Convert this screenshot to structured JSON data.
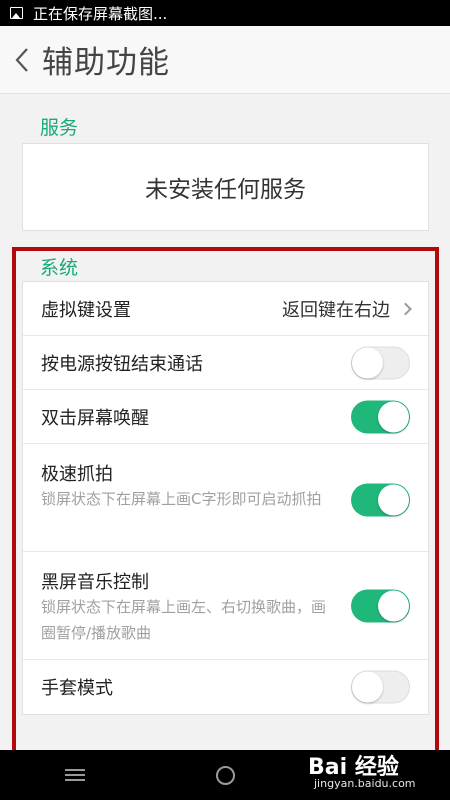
{
  "status_bar": {
    "notification_text": "正在保存屏幕截图..."
  },
  "app_bar": {
    "title": "辅助功能"
  },
  "services": {
    "header": "服务",
    "empty_text": "未安装任何服务"
  },
  "system": {
    "header": "系统",
    "items": [
      {
        "label": "虚拟键设置",
        "value": "返回键在右边"
      },
      {
        "label": "按电源按钮结束通话",
        "enabled": false
      },
      {
        "label": "双击屏幕唤醒",
        "enabled": true
      },
      {
        "label": "极速抓拍",
        "description": "锁屏状态下在屏幕上画C字形即可启动抓拍",
        "enabled": true
      },
      {
        "label": "黑屏音乐控制",
        "description": "锁屏状态下在屏幕上画左、右切换歌曲，画圈暂停/播放歌曲",
        "enabled": true
      },
      {
        "label": "手套模式",
        "enabled": false
      }
    ]
  },
  "watermark": {
    "brand": "Bai 经验",
    "url": "jingyan.baidu.com"
  },
  "colors": {
    "accent": "#1aa974",
    "toggle_on": "#20b77a",
    "highlight_border": "#b3080d"
  }
}
